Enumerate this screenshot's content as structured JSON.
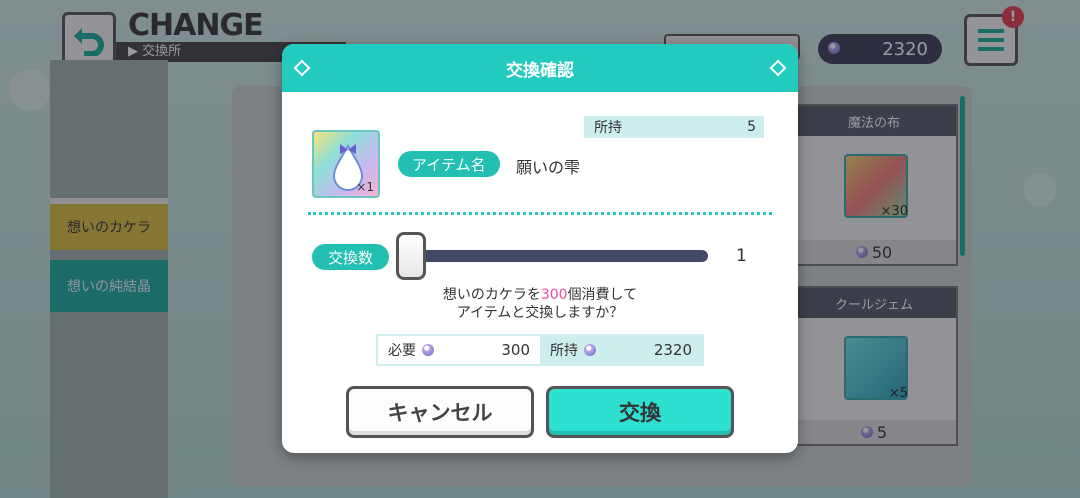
{
  "header": {
    "title": "CHANGE",
    "subtitle": "▶ 交換所"
  },
  "currency": {
    "amount": "2320",
    "icon": "crystal-gem-icon"
  },
  "menu": {
    "badge": "!"
  },
  "sidebar": {
    "items": [
      {
        "label": "想いのカケラ"
      },
      {
        "label": "想いの純結晶"
      }
    ]
  },
  "cards": [
    {
      "name": "魔法の布",
      "count": "×30",
      "price": "50"
    },
    {
      "name": "クールジェム",
      "count": "×5",
      "price": "5"
    }
  ],
  "modal": {
    "title": "交換確認",
    "owned_label": "所持",
    "owned_value": "5",
    "item_thumb_count": "×1",
    "item_name_label": "アイテム名",
    "item_name": "願いの雫",
    "qty_label": "交換数",
    "qty_value": "1",
    "slider_fraction": 0,
    "message_line1_a": "想いのカケラを",
    "message_line1_hl": "300",
    "message_line1_b": "個消費して",
    "message_line2": "アイテムと交換しますか？",
    "need_label": "必要",
    "need_value": "300",
    "have_label": "所持",
    "have_value": "2320",
    "cancel_label": "キャンセル",
    "ok_label": "交換"
  },
  "colors": {
    "accent": "#22cbbd",
    "highlight": "#ee4d9b",
    "dark": "#444a66"
  }
}
